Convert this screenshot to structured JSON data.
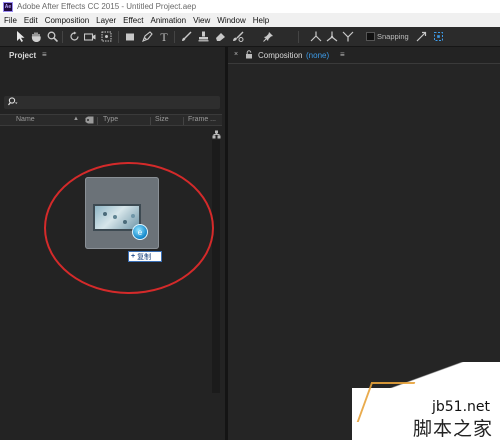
{
  "window": {
    "app_icon_text": "Ae",
    "title": "Adobe After Effects CC 2015 - Untitled Project.aep"
  },
  "menu": [
    "File",
    "Edit",
    "Composition",
    "Layer",
    "Effect",
    "Animation",
    "View",
    "Window",
    "Help"
  ],
  "toolbar": {
    "tools": [
      "selection-tool",
      "hand-tool",
      "zoom-tool",
      "rotation-tool",
      "camera-tool",
      "pan-behind-tool",
      "rectangle-tool",
      "pen-tool",
      "type-tool",
      "brush-tool",
      "clone-stamp-tool",
      "eraser-tool",
      "roto-brush-tool",
      "puppet-pin-tool"
    ],
    "snapping_label": "Snapping",
    "snapping_checked": false
  },
  "project_panel": {
    "tab_label": "Project",
    "menu_glyph": "≡",
    "search_value": "",
    "columns": [
      "Name",
      "Type",
      "Size",
      "Frame ..."
    ],
    "drag_tooltip": "复制",
    "drag_tooltip_plus": "+"
  },
  "composition_panel": {
    "close_glyph": "×",
    "tab_label": "Composition",
    "tab_value": "(none)",
    "menu_glyph": "≡"
  },
  "watermark": {
    "url": "jb51.net",
    "cn_text": "脚本之家"
  },
  "colors": {
    "accent_blue": "#3d9be8",
    "annotation_red": "#d42a2a",
    "panel_bg": "#232323"
  }
}
